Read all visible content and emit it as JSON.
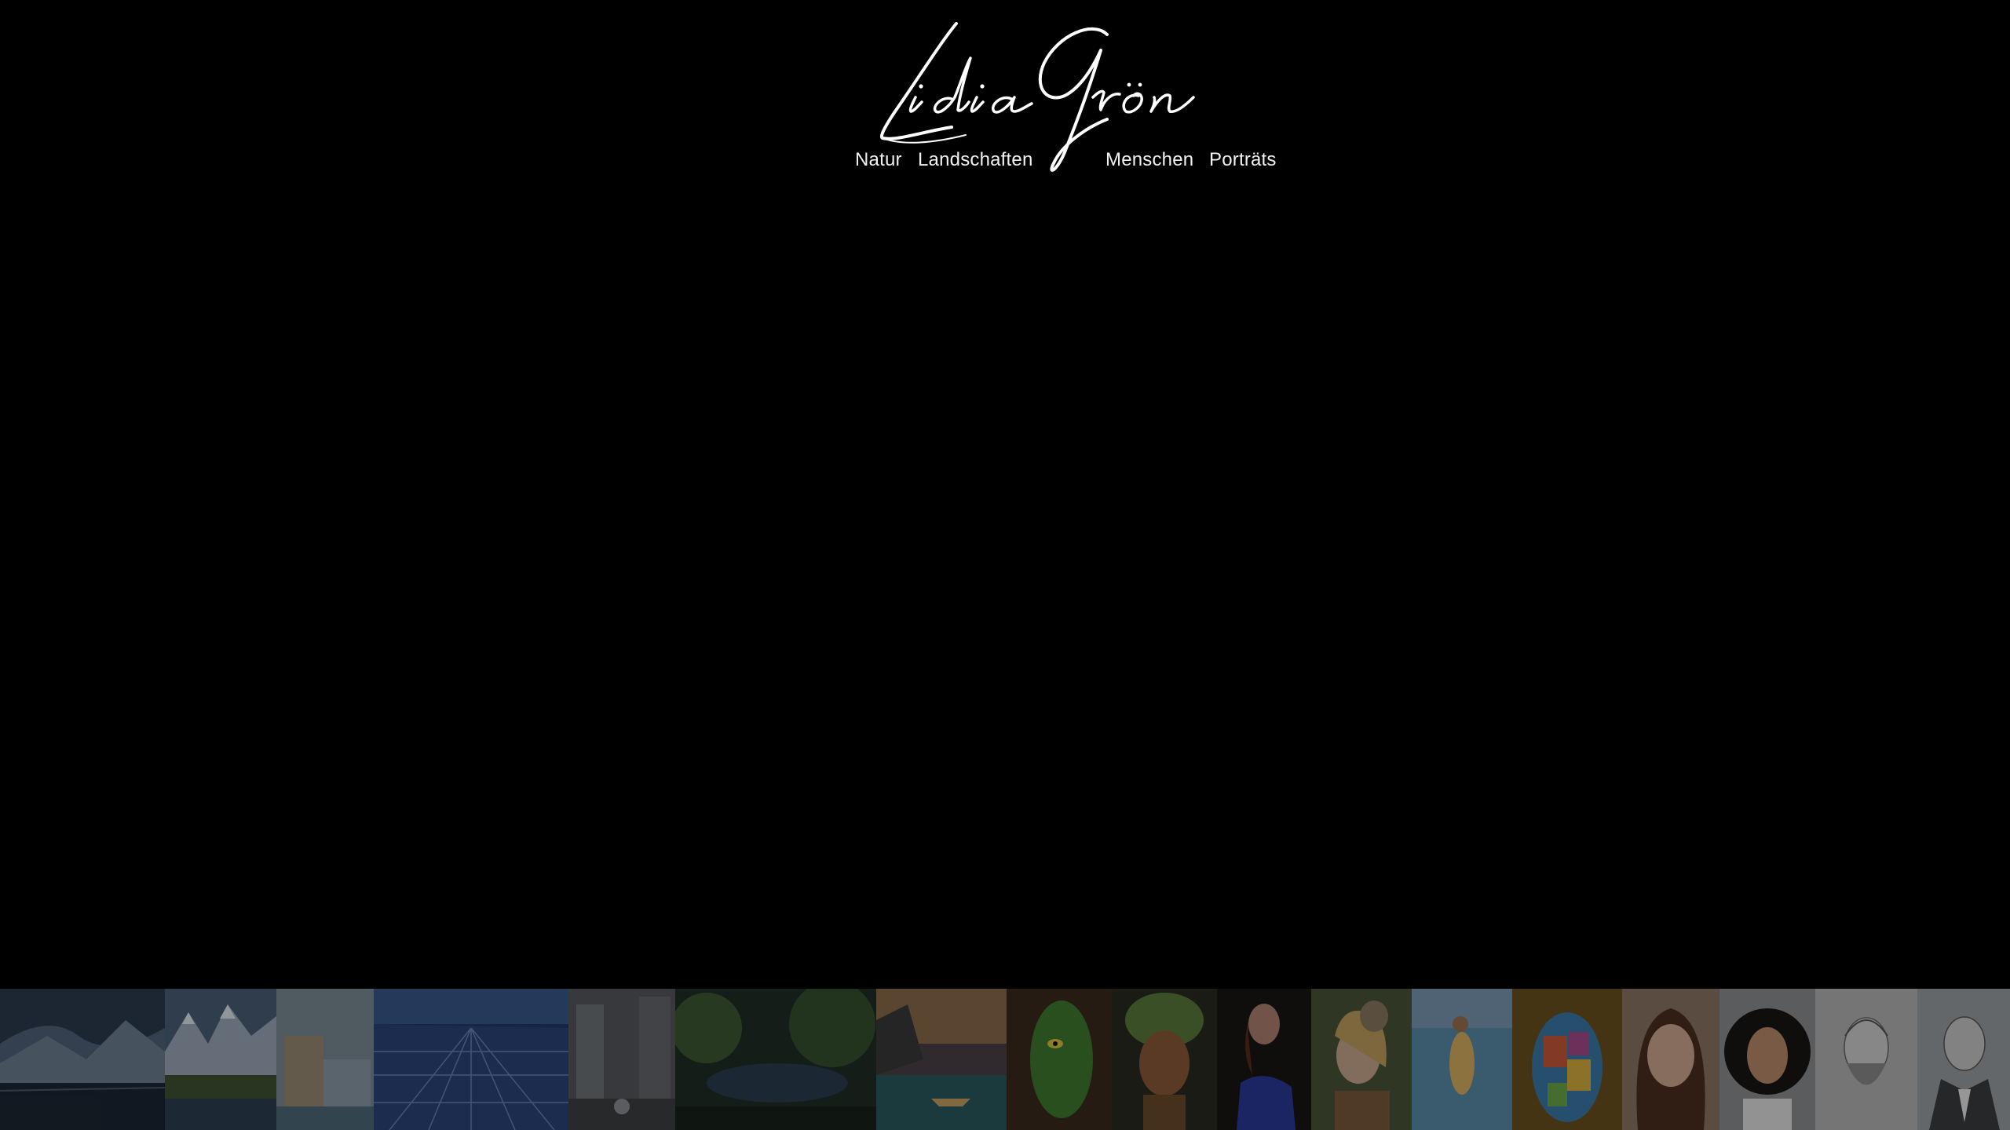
{
  "brand": {
    "signature": "Lidia Grön"
  },
  "nav": {
    "items": [
      "Natur",
      "Landschaften",
      "Menschen",
      "Porträts"
    ]
  },
  "colors": {
    "background": "#000000",
    "text": "#ffffff"
  },
  "gallery": {
    "thumbnails": [
      {
        "subject": "mountain lake landscape painting"
      },
      {
        "subject": "snowy mountains and meadow painting"
      },
      {
        "subject": "mediterranean village painting"
      },
      {
        "subject": "aerial city at dusk painting"
      },
      {
        "subject": "rainy city street painting"
      },
      {
        "subject": "forest river at night painting"
      },
      {
        "subject": "seaside cliffs with boat painting"
      },
      {
        "subject": "green face in tree painting"
      },
      {
        "subject": "woman with headwrap portrait"
      },
      {
        "subject": "woman in blue dress portrait"
      },
      {
        "subject": "woman with owl painting"
      },
      {
        "subject": "pregnant woman at sea painting"
      },
      {
        "subject": "colorful mosaic face painting"
      },
      {
        "subject": "woman with brown hair portrait"
      },
      {
        "subject": "woman with curly hair portrait"
      },
      {
        "subject": "bearded man pencil portrait"
      },
      {
        "subject": "man in suit portrait"
      }
    ]
  }
}
